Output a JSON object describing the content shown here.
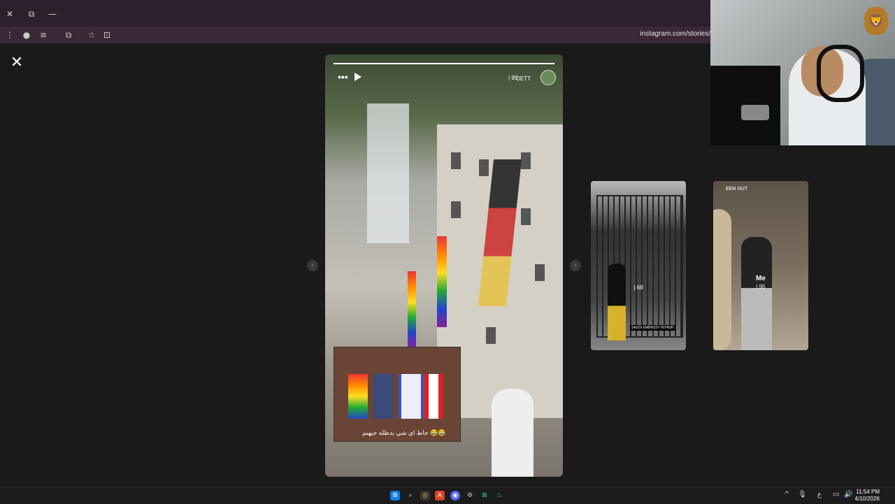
{
  "browser": {
    "window_buttons": {
      "close": "✕",
      "restore": "⧉",
      "minimize": "—"
    },
    "toolbar_icons": {
      "menu": "⋮",
      "profile": "●",
      "media": "≡",
      "extensions": "⧉",
      "bookmark": "☆",
      "tab_search": "⊡"
    },
    "url": "instagram.com/stories/"
  },
  "viewer": {
    "close": "✕",
    "prev_arrow": "‹",
    "next_arrow": "›",
    "story": {
      "menu": "•••",
      "username": "DETT",
      "count": "| 95",
      "progress": 1.0,
      "inset_caption": "حاط اي شي بدطله جيهنم 😂😂"
    },
    "thumbnails": [
      {
        "count": "| 68",
        "caption": "SAUDI EMBASSY RIYADH"
      },
      {
        "tag": "EEN OUT",
        "name": "Me",
        "count": "| 95"
      }
    ]
  },
  "overlay": {
    "logo": "🦁"
  },
  "taskbar": {
    "icons": [
      "⊞",
      "⌕",
      "◎",
      "A",
      "◉",
      "⚙",
      "⊠",
      "♨"
    ],
    "tray": {
      "chevron": "^",
      "mic": "🎙",
      "lang": "ع",
      "network": "▭",
      "volume": "🔊"
    },
    "time": "11:54 PM",
    "date": "4/10/2026"
  },
  "colors": {
    "titlebar": "#2d1f2b",
    "page_bg": "#1a1a1a",
    "taskbar": "#1c1c1c"
  }
}
